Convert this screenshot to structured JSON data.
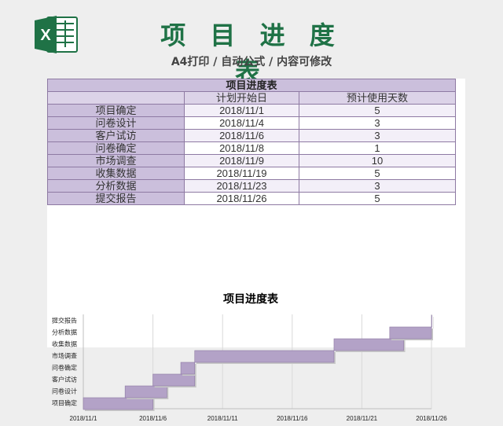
{
  "header": {
    "title": "项 目 进 度 表",
    "subtitle": "A4打印 / 自动公式 / 内容可修改"
  },
  "logo": {
    "letter": "X",
    "color": "#1f7246"
  },
  "table": {
    "title": "项目进度表",
    "columns": [
      "",
      "计划开始日",
      "预计使用天数"
    ],
    "rows": [
      {
        "task": "项目确定",
        "start": "2018/11/1",
        "days": "5"
      },
      {
        "task": "问卷设计",
        "start": "2018/11/4",
        "days": "3"
      },
      {
        "task": "客户试访",
        "start": "2018/11/6",
        "days": "3"
      },
      {
        "task": "问卷确定",
        "start": "2018/11/8",
        "days": "1"
      },
      {
        "task": "市场调查",
        "start": "2018/11/9",
        "days": "10"
      },
      {
        "task": "收集数据",
        "start": "2018/11/19",
        "days": "5"
      },
      {
        "task": "分析数据",
        "start": "2018/11/23",
        "days": "3"
      },
      {
        "task": "提交报告",
        "start": "2018/11/26",
        "days": "5"
      }
    ]
  },
  "chart_data": {
    "type": "bar",
    "subtype": "gantt",
    "title": "项目进度表",
    "categories": [
      "项目确定",
      "问卷设计",
      "客户试访",
      "问卷确定",
      "市场调查",
      "收集数据",
      "分析数据",
      "提交报告"
    ],
    "start": [
      "2018/11/1",
      "2018/11/4",
      "2018/11/6",
      "2018/11/8",
      "2018/11/9",
      "2018/11/19",
      "2018/11/23",
      "2018/11/26"
    ],
    "duration_days": [
      5,
      3,
      3,
      1,
      10,
      5,
      3,
      5
    ],
    "xlim": [
      "2018/11/1",
      "2018/11/26"
    ],
    "xticks": [
      "2018/11/1",
      "2018/11/6",
      "2018/11/11",
      "2018/11/16",
      "2018/11/21",
      "2018/11/26"
    ],
    "bar_color": "#b3a2c7",
    "grid": "vertical"
  }
}
